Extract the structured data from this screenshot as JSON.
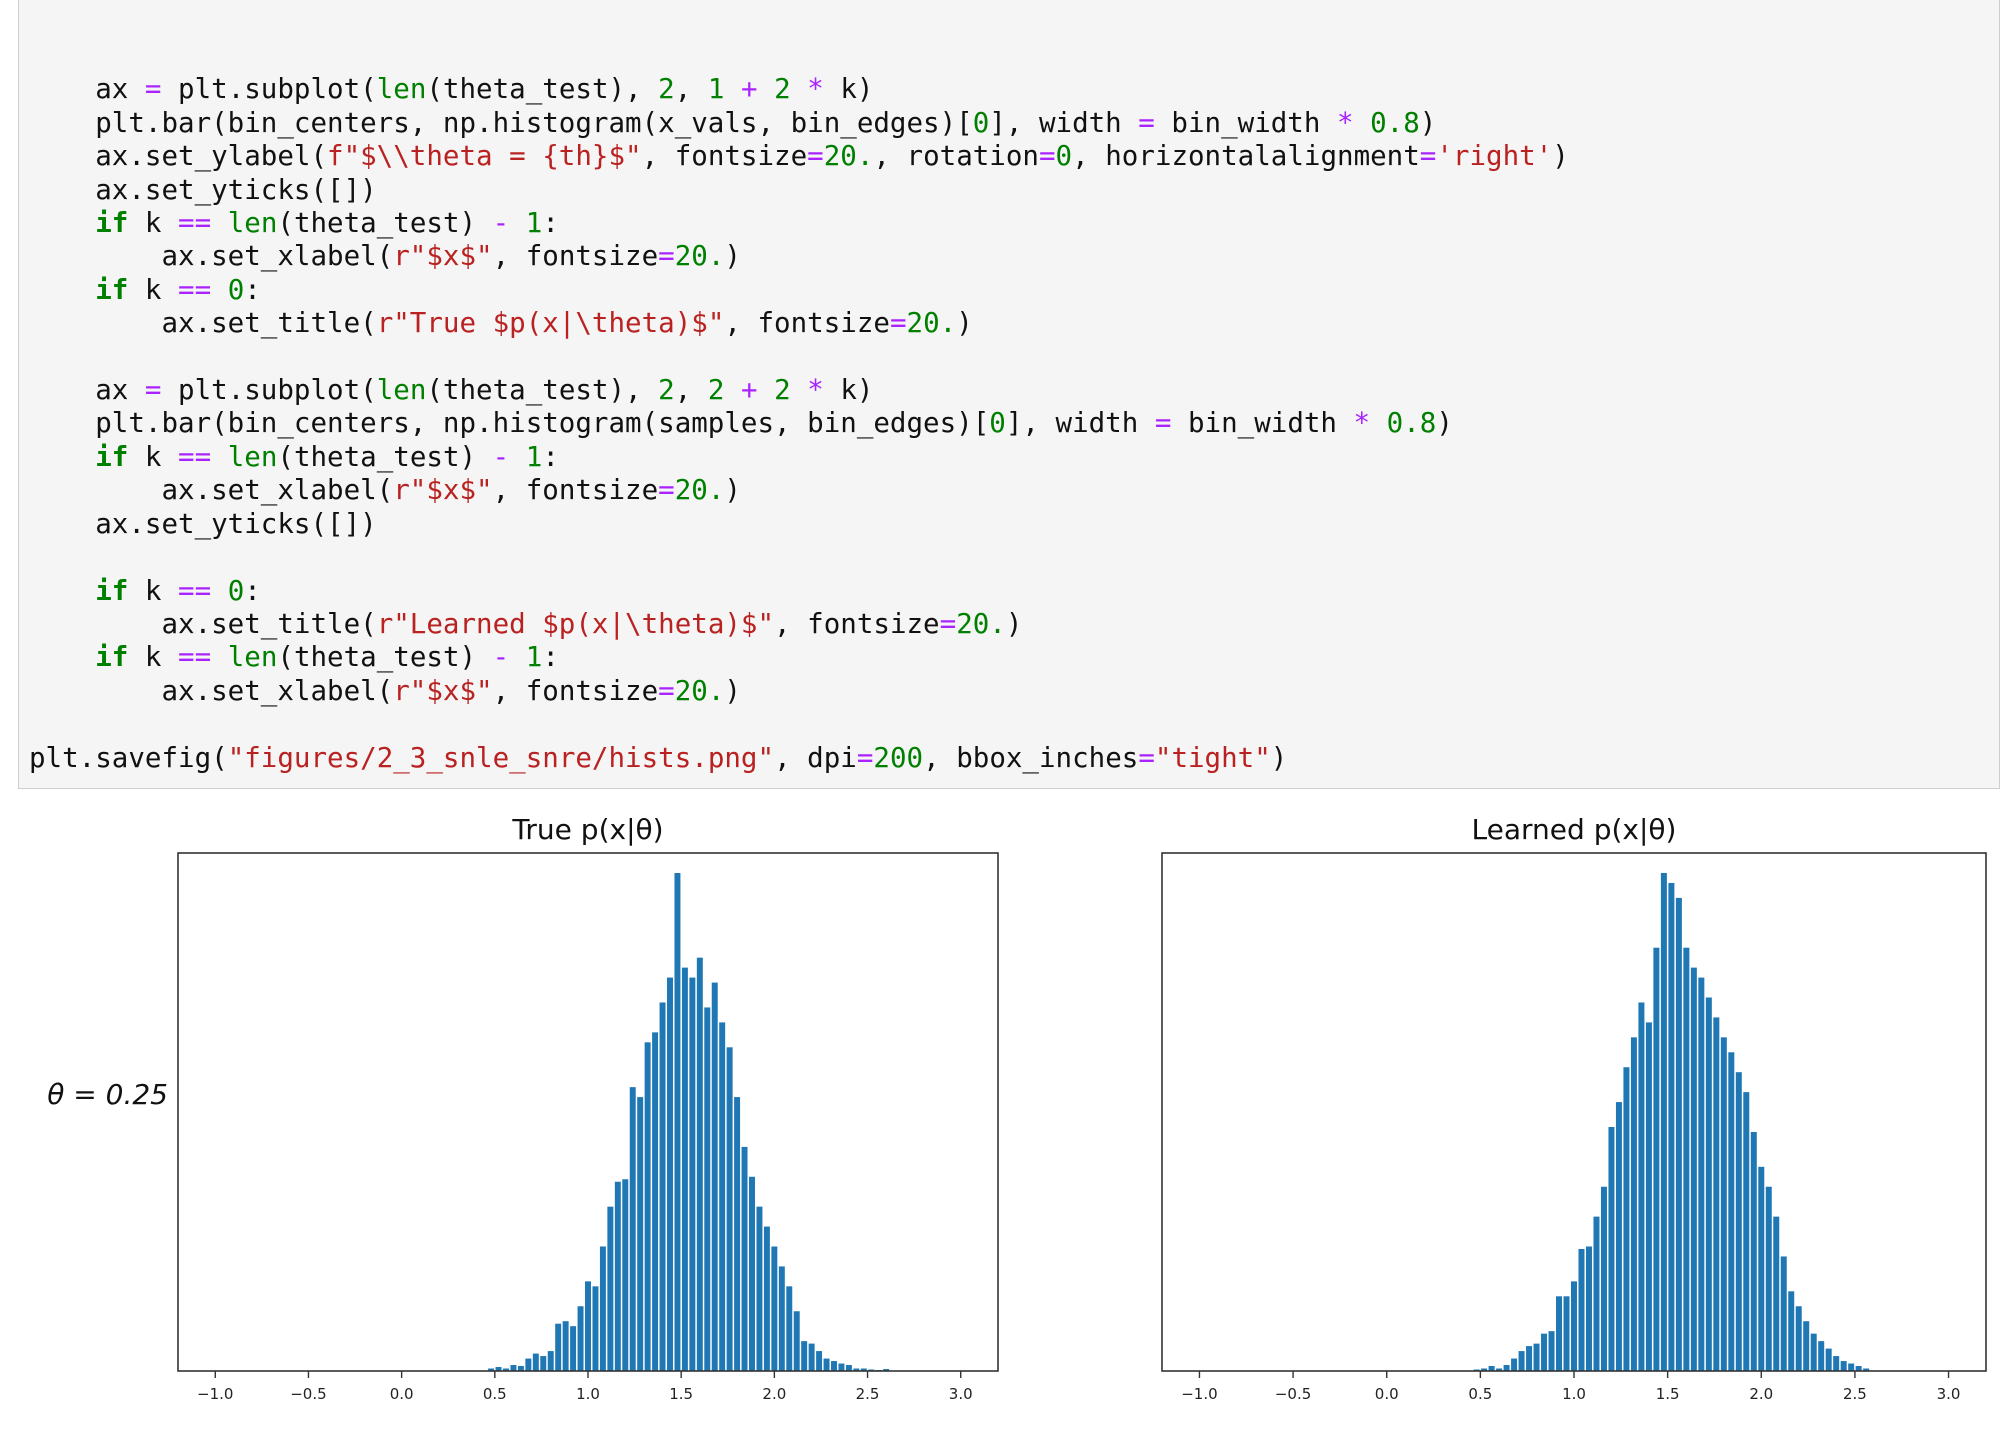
{
  "code_lines": [
    [],
    [
      {
        "t": "    ax ",
        "c": ""
      },
      {
        "t": "=",
        "c": "op"
      },
      {
        "t": " plt.subplot(",
        "c": ""
      },
      {
        "t": "len",
        "c": "bi"
      },
      {
        "t": "(theta_test), ",
        "c": ""
      },
      {
        "t": "2",
        "c": "num"
      },
      {
        "t": ", ",
        "c": ""
      },
      {
        "t": "1",
        "c": "num"
      },
      {
        "t": " ",
        "c": ""
      },
      {
        "t": "+",
        "c": "op"
      },
      {
        "t": " ",
        "c": ""
      },
      {
        "t": "2",
        "c": "num"
      },
      {
        "t": " ",
        "c": ""
      },
      {
        "t": "*",
        "c": "op"
      },
      {
        "t": " k)",
        "c": ""
      }
    ],
    [
      {
        "t": "    plt.bar(bin_centers, np.histogram(x_vals, bin_edges)[",
        "c": ""
      },
      {
        "t": "0",
        "c": "num"
      },
      {
        "t": "], width ",
        "c": ""
      },
      {
        "t": "=",
        "c": "op"
      },
      {
        "t": " bin_width ",
        "c": ""
      },
      {
        "t": "*",
        "c": "op"
      },
      {
        "t": " ",
        "c": ""
      },
      {
        "t": "0.8",
        "c": "num"
      },
      {
        "t": ")",
        "c": ""
      }
    ],
    [
      {
        "t": "    ax.set_ylabel(",
        "c": ""
      },
      {
        "t": "f\"$\\\\theta = {th}$\"",
        "c": "str"
      },
      {
        "t": ", fontsize",
        "c": ""
      },
      {
        "t": "=",
        "c": "op"
      },
      {
        "t": "20.",
        "c": "num"
      },
      {
        "t": ", rotation",
        "c": ""
      },
      {
        "t": "=",
        "c": "op"
      },
      {
        "t": "0",
        "c": "num"
      },
      {
        "t": ", horizontalalignment",
        "c": ""
      },
      {
        "t": "=",
        "c": "op"
      },
      {
        "t": "'right'",
        "c": "str"
      },
      {
        "t": ")",
        "c": ""
      }
    ],
    [
      {
        "t": "    ax.set_yticks([])",
        "c": ""
      }
    ],
    [
      {
        "t": "    ",
        "c": ""
      },
      {
        "t": "if",
        "c": "kw"
      },
      {
        "t": " k ",
        "c": ""
      },
      {
        "t": "==",
        "c": "op"
      },
      {
        "t": " ",
        "c": ""
      },
      {
        "t": "len",
        "c": "bi"
      },
      {
        "t": "(theta_test) ",
        "c": ""
      },
      {
        "t": "-",
        "c": "op"
      },
      {
        "t": " ",
        "c": ""
      },
      {
        "t": "1",
        "c": "num"
      },
      {
        "t": ":",
        "c": ""
      }
    ],
    [
      {
        "t": "        ax.set_xlabel(",
        "c": ""
      },
      {
        "t": "r\"$x$\"",
        "c": "str"
      },
      {
        "t": ", fontsize",
        "c": ""
      },
      {
        "t": "=",
        "c": "op"
      },
      {
        "t": "20.",
        "c": "num"
      },
      {
        "t": ")",
        "c": ""
      }
    ],
    [
      {
        "t": "    ",
        "c": ""
      },
      {
        "t": "if",
        "c": "kw"
      },
      {
        "t": " k ",
        "c": ""
      },
      {
        "t": "==",
        "c": "op"
      },
      {
        "t": " ",
        "c": ""
      },
      {
        "t": "0",
        "c": "num"
      },
      {
        "t": ":",
        "c": ""
      }
    ],
    [
      {
        "t": "        ax.set_title(",
        "c": ""
      },
      {
        "t": "r\"True $p(x|\\theta)$\"",
        "c": "str"
      },
      {
        "t": ", fontsize",
        "c": ""
      },
      {
        "t": "=",
        "c": "op"
      },
      {
        "t": "20.",
        "c": "num"
      },
      {
        "t": ")",
        "c": ""
      }
    ],
    [],
    [
      {
        "t": "    ax ",
        "c": ""
      },
      {
        "t": "=",
        "c": "op"
      },
      {
        "t": " plt.subplot(",
        "c": ""
      },
      {
        "t": "len",
        "c": "bi"
      },
      {
        "t": "(theta_test), ",
        "c": ""
      },
      {
        "t": "2",
        "c": "num"
      },
      {
        "t": ", ",
        "c": ""
      },
      {
        "t": "2",
        "c": "num"
      },
      {
        "t": " ",
        "c": ""
      },
      {
        "t": "+",
        "c": "op"
      },
      {
        "t": " ",
        "c": ""
      },
      {
        "t": "2",
        "c": "num"
      },
      {
        "t": " ",
        "c": ""
      },
      {
        "t": "*",
        "c": "op"
      },
      {
        "t": " k)",
        "c": ""
      }
    ],
    [
      {
        "t": "    plt.bar(bin_centers, np.histogram(samples, bin_edges)[",
        "c": ""
      },
      {
        "t": "0",
        "c": "num"
      },
      {
        "t": "], width ",
        "c": ""
      },
      {
        "t": "=",
        "c": "op"
      },
      {
        "t": " bin_width ",
        "c": ""
      },
      {
        "t": "*",
        "c": "op"
      },
      {
        "t": " ",
        "c": ""
      },
      {
        "t": "0.8",
        "c": "num"
      },
      {
        "t": ")",
        "c": ""
      }
    ],
    [
      {
        "t": "    ",
        "c": ""
      },
      {
        "t": "if",
        "c": "kw"
      },
      {
        "t": " k ",
        "c": ""
      },
      {
        "t": "==",
        "c": "op"
      },
      {
        "t": " ",
        "c": ""
      },
      {
        "t": "len",
        "c": "bi"
      },
      {
        "t": "(theta_test) ",
        "c": ""
      },
      {
        "t": "-",
        "c": "op"
      },
      {
        "t": " ",
        "c": ""
      },
      {
        "t": "1",
        "c": "num"
      },
      {
        "t": ":",
        "c": ""
      }
    ],
    [
      {
        "t": "        ax.set_xlabel(",
        "c": ""
      },
      {
        "t": "r\"$x$\"",
        "c": "str"
      },
      {
        "t": ", fontsize",
        "c": ""
      },
      {
        "t": "=",
        "c": "op"
      },
      {
        "t": "20.",
        "c": "num"
      },
      {
        "t": ")",
        "c": ""
      }
    ],
    [
      {
        "t": "    ax.set_yticks([])",
        "c": ""
      }
    ],
    [],
    [
      {
        "t": "    ",
        "c": ""
      },
      {
        "t": "if",
        "c": "kw"
      },
      {
        "t": " k ",
        "c": ""
      },
      {
        "t": "==",
        "c": "op"
      },
      {
        "t": " ",
        "c": ""
      },
      {
        "t": "0",
        "c": "num"
      },
      {
        "t": ":",
        "c": ""
      }
    ],
    [
      {
        "t": "        ax.set_title(",
        "c": ""
      },
      {
        "t": "r\"Learned $p(x|\\theta)$\"",
        "c": "str"
      },
      {
        "t": ", fontsize",
        "c": ""
      },
      {
        "t": "=",
        "c": "op"
      },
      {
        "t": "20.",
        "c": "num"
      },
      {
        "t": ")",
        "c": ""
      }
    ],
    [
      {
        "t": "    ",
        "c": ""
      },
      {
        "t": "if",
        "c": "kw"
      },
      {
        "t": " k ",
        "c": ""
      },
      {
        "t": "==",
        "c": "op"
      },
      {
        "t": " ",
        "c": ""
      },
      {
        "t": "len",
        "c": "bi"
      },
      {
        "t": "(theta_test) ",
        "c": ""
      },
      {
        "t": "-",
        "c": "op"
      },
      {
        "t": " ",
        "c": ""
      },
      {
        "t": "1",
        "c": "num"
      },
      {
        "t": ":",
        "c": ""
      }
    ],
    [
      {
        "t": "        ax.set_xlabel(",
        "c": ""
      },
      {
        "t": "r\"$x$\"",
        "c": "str"
      },
      {
        "t": ", fontsize",
        "c": ""
      },
      {
        "t": "=",
        "c": "op"
      },
      {
        "t": "20.",
        "c": "num"
      },
      {
        "t": ")",
        "c": ""
      }
    ],
    [],
    [
      {
        "t": "plt.savefig(",
        "c": ""
      },
      {
        "t": "\"figures/2_3_snle_snre/hists.png\"",
        "c": "str"
      },
      {
        "t": ", dpi",
        "c": ""
      },
      {
        "t": "=",
        "c": "op"
      },
      {
        "t": "200",
        "c": "num"
      },
      {
        "t": ", bbox_inches",
        "c": ""
      },
      {
        "t": "=",
        "c": "op"
      },
      {
        "t": "\"tight\"",
        "c": "str"
      },
      {
        "t": ")",
        "c": ""
      }
    ]
  ],
  "output": {
    "row_label": "θ = 0.25"
  },
  "chart_data": [
    {
      "type": "bar",
      "title": "True p(x|θ)",
      "xlabel": "",
      "ylabel": "θ = 0.25",
      "xlim": [
        -1.2,
        3.2
      ],
      "xticks": [
        -1.0,
        -0.5,
        0.0,
        0.5,
        1.0,
        1.5,
        2.0,
        2.5,
        3.0
      ],
      "xtick_labels": [
        "−1.0",
        "−0.5",
        "0.0",
        "0.5",
        "1.0",
        "1.5",
        "2.0",
        "2.5",
        "3.0"
      ],
      "yticks": [],
      "bar_color": "#1f77b4",
      "ylim": [
        0,
        100
      ],
      "x": [
        0.48,
        0.52,
        0.56,
        0.6,
        0.64,
        0.68,
        0.72,
        0.76,
        0.8,
        0.84,
        0.88,
        0.92,
        0.96,
        1.0,
        1.04,
        1.08,
        1.12,
        1.16,
        1.2,
        1.24,
        1.28,
        1.32,
        1.36,
        1.4,
        1.44,
        1.48,
        1.52,
        1.56,
        1.6,
        1.64,
        1.68,
        1.72,
        1.76,
        1.8,
        1.84,
        1.88,
        1.92,
        1.96,
        2.0,
        2.04,
        2.08,
        2.12,
        2.16,
        2.2,
        2.24,
        2.28,
        2.32,
        2.36,
        2.4,
        2.44,
        2.48,
        2.52,
        2.56,
        2.6
      ],
      "values": [
        0.5,
        0.8,
        0.5,
        1.2,
        1.0,
        2.5,
        3.5,
        3.0,
        4.0,
        9.5,
        10.0,
        9.0,
        13.0,
        18.0,
        17.0,
        25.0,
        33.0,
        38.0,
        38.5,
        57.0,
        55.0,
        66.0,
        68.0,
        74.0,
        79.0,
        100.0,
        81.0,
        79.0,
        83.0,
        73.0,
        78.0,
        70.0,
        65.0,
        55.0,
        45.0,
        39.0,
        33.0,
        29.0,
        25.0,
        21.0,
        17.0,
        12.0,
        6.0,
        5.5,
        4.0,
        2.5,
        2.0,
        1.5,
        1.2,
        0.5,
        0.5,
        0.3,
        0.2,
        0.4
      ]
    },
    {
      "type": "bar",
      "title": "Learned p(x|θ)",
      "xlabel": "",
      "xlim": [
        -1.2,
        3.2
      ],
      "xticks": [
        -1.0,
        -0.5,
        0.0,
        0.5,
        1.0,
        1.5,
        2.0,
        2.5,
        3.0
      ],
      "xtick_labels": [
        "−1.0",
        "−0.5",
        "0.0",
        "0.5",
        "1.0",
        "1.5",
        "2.0",
        "2.5",
        "3.0"
      ],
      "yticks": [],
      "bar_color": "#1f77b4",
      "ylim": [
        0,
        100
      ],
      "x": [
        0.48,
        0.52,
        0.56,
        0.6,
        0.64,
        0.68,
        0.72,
        0.76,
        0.8,
        0.84,
        0.88,
        0.92,
        0.96,
        1.0,
        1.04,
        1.08,
        1.12,
        1.16,
        1.2,
        1.24,
        1.28,
        1.32,
        1.36,
        1.4,
        1.44,
        1.48,
        1.52,
        1.56,
        1.6,
        1.64,
        1.68,
        1.72,
        1.76,
        1.8,
        1.84,
        1.88,
        1.92,
        1.96,
        2.0,
        2.04,
        2.08,
        2.12,
        2.16,
        2.2,
        2.24,
        2.28,
        2.32,
        2.36,
        2.4,
        2.44,
        2.48,
        2.52,
        2.56
      ],
      "values": [
        0.3,
        0.5,
        1.0,
        0.5,
        1.2,
        2.5,
        4.0,
        5.0,
        5.5,
        7.5,
        8.0,
        15.0,
        15.0,
        18.0,
        24.5,
        25.0,
        31.0,
        37.0,
        49.0,
        54.0,
        61.0,
        67.0,
        74.0,
        70.0,
        85.0,
        100.0,
        98.0,
        95.0,
        85.0,
        81.0,
        79.0,
        75.0,
        71.0,
        67.0,
        64.0,
        60.0,
        56.0,
        48.0,
        41.0,
        37.0,
        31.0,
        23.0,
        16.0,
        13.0,
        10.0,
        7.5,
        6.0,
        4.5,
        3.0,
        2.0,
        1.5,
        1.0,
        0.5
      ]
    }
  ]
}
